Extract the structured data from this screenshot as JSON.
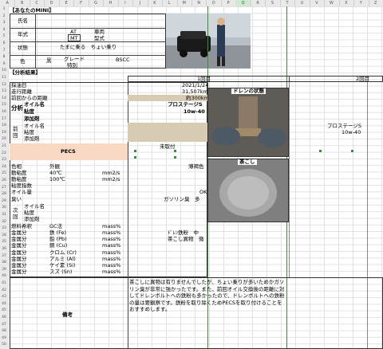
{
  "columns": [
    "A",
    "B",
    "C",
    "D",
    "E",
    "F",
    "G",
    "H",
    "I",
    "J",
    "K",
    "L",
    "M",
    "N",
    "O",
    "P",
    "Q",
    "R",
    "S",
    "T",
    "U",
    "V",
    "W",
    "X",
    "Y",
    "Z"
  ],
  "selected_column": "Q",
  "rows": [
    "1",
    "2",
    "3",
    "4",
    "5",
    "6",
    "7",
    "8",
    "9",
    "10",
    "11",
    "12",
    "13",
    "14",
    "15",
    "16",
    "17",
    "18",
    "19",
    "20",
    "21",
    "22",
    "23",
    "24",
    "25",
    "26",
    "27",
    "28",
    "29",
    "30",
    "31",
    "32",
    "33",
    "34",
    "35",
    "36",
    "37",
    "38",
    "39",
    "40",
    "41",
    "42",
    "43",
    "44",
    "45",
    "46",
    "47",
    "48",
    "49",
    "50"
  ],
  "your_mini": {
    "section_title": "【あなたのMINI】",
    "owner_label": "氏名",
    "year_label": "年式",
    "transmission_options": [
      "AT",
      "MT"
    ],
    "transmission_selected": "MT",
    "vehicle_label": "車両",
    "model_label": "型式",
    "state_label": "状態",
    "state_value": "たまに乗る　ちょい乗り",
    "color_label": "色",
    "color_value": "黒",
    "grade_label": "グレード",
    "grade_sub": "特別",
    "grade_value": "BSCC"
  },
  "analysis": {
    "section_title": "【分析結果】",
    "round1": "1回目",
    "round2": "2回目",
    "sample_date_label": "採油日",
    "sample_date": "2021/1/24",
    "mileage_label": "走行距離",
    "mileage": "31,507km",
    "since_prev_label": "前回からの距離",
    "since_prev": "約300km",
    "oil_section": "分析",
    "oil_name_label": "オイル名",
    "oil_name": "プロステージS",
    "viscosity_label": "粘度",
    "viscosity": "10w-40",
    "additive_label": "添加剤",
    "prev_section": "前回",
    "prev_oil_name": "プロステージS",
    "prev_viscosity": "10w-40",
    "pecs_label": "PECS",
    "pecs_value": "未取付",
    "color_label": "色相",
    "color_sub": "外観",
    "color_value": "薄褐色",
    "visc40_label": "動粘度",
    "visc40_temp": "40℃",
    "visc_unit": "mm2/s",
    "visc100_label": "動粘度",
    "visc100_temp": "100℃",
    "vi_label": "粘度指数",
    "oil_amount_label": "オイル量",
    "oil_amount": "OK",
    "smell_label": "臭い",
    "smell_value": "ガソリン臭　多",
    "next_section": "次回",
    "next_oil_name_label": "オイル名",
    "next_visc_label": "粘度",
    "next_add_label": "添加剤",
    "fuel_label": "燃料希釈",
    "fuel_sub": "GC法",
    "mass_unit": "mass%",
    "metals_label": "金属分",
    "metals": [
      {
        "name": "鉄 (Fe)",
        "note": "ﾄﾞﾚﾝ鉄粉　中"
      },
      {
        "name": "鉛 (Pb)",
        "note": "茶こし異物　微"
      },
      {
        "name": "銅 (Cu)",
        "note": ""
      },
      {
        "name": "クロム (Cr)",
        "note": ""
      },
      {
        "name": "アルミ (Al)",
        "note": ""
      },
      {
        "name": "ケイ素 (Si)",
        "note": ""
      },
      {
        "name": "スズ (Sn)",
        "note": ""
      }
    ],
    "drain_title": "ドレンの状態",
    "strainer_title": "茶こし",
    "remarks_label": "備考",
    "remarks": "茶こしに異物は有りませんでしたが、ちょい乗りが多いためかガソリン臭が非常に強かったです。また、前回オイル交換後の距離に対してドレンボルトへの鉄粉も多かったので、ドレンボルトへの鉄粉の量は要観察です。鉄粉を取り除くためPECSを取り付けることをおすすめします。"
  }
}
